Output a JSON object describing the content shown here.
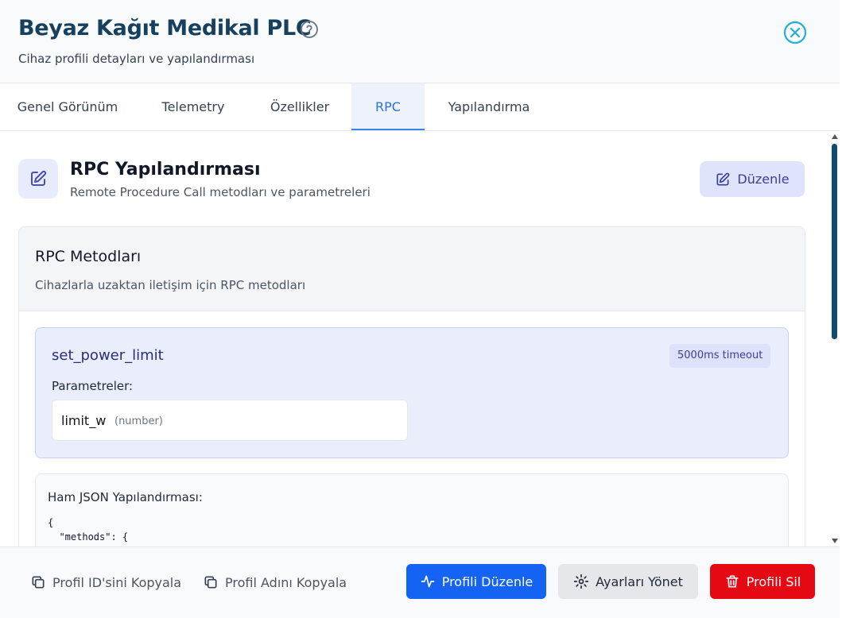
{
  "header": {
    "title": "Beyaz Kağıt Medikal PLC",
    "subtitle": "Cihaz profili detayları ve yapılandırması",
    "help_icon": "question-circle-icon",
    "close_icon": "close-circle-icon"
  },
  "tabs": [
    {
      "label": "Genel Görünüm",
      "active": false
    },
    {
      "label": "Telemetry",
      "active": false
    },
    {
      "label": "Özellikler",
      "active": false
    },
    {
      "label": "RPC",
      "active": true
    },
    {
      "label": "Yapılandırma",
      "active": false
    }
  ],
  "section": {
    "icon": "edit-square-icon",
    "title": "RPC Yapılandırması",
    "subtitle": "Remote Procedure Call metodları ve parametreleri",
    "edit_label": "Düzenle"
  },
  "card": {
    "title": "RPC Metodları",
    "subtitle": "Cihazlarla uzaktan iletişim için RPC metodları",
    "method": {
      "name": "set_power_limit",
      "timeout": "5000ms timeout",
      "params_label": "Parametreler:",
      "param_name": "limit_w",
      "param_type": "(number)"
    },
    "json_label": "Ham JSON Yapılandırması:",
    "json_code": "{\n  \"methods\": {"
  },
  "footer": {
    "copy_id": "Profil ID'sini Kopyala",
    "copy_name": "Profil Adını Kopyala",
    "edit_profile": "Profili Düzenle",
    "manage_settings": "Ayarları Yönet",
    "delete_profile": "Profili Sil"
  },
  "colors": {
    "primary": "#1463f3",
    "danger": "#e50914",
    "title": "#16405e",
    "accent_tab": "#2e71d6"
  }
}
